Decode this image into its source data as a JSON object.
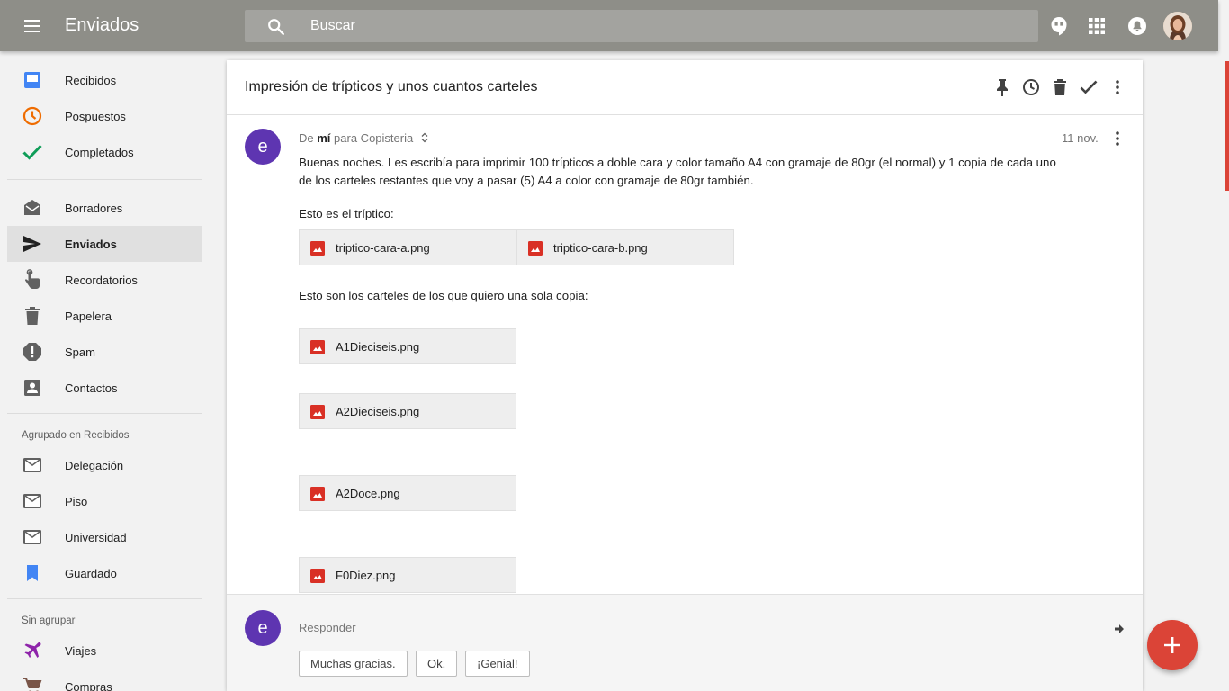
{
  "header": {
    "title": "Enviados",
    "search_placeholder": "Buscar"
  },
  "sidebar": {
    "items": [
      {
        "label": "Recibidos",
        "icon": "inbox-icon",
        "color": "#4285f4"
      },
      {
        "label": "Pospuestos",
        "icon": "clock-icon",
        "color": "#ef6c00"
      },
      {
        "label": "Completados",
        "icon": "check-icon",
        "color": "#0f9d58"
      },
      {
        "label": "Borradores",
        "icon": "drafts-icon",
        "color": "#616161"
      },
      {
        "label": "Enviados",
        "icon": "send-icon",
        "color": "#212121",
        "active": true
      },
      {
        "label": "Recordatorios",
        "icon": "finger-icon",
        "color": "#616161"
      },
      {
        "label": "Papelera",
        "icon": "trash-icon",
        "color": "#616161"
      },
      {
        "label": "Spam",
        "icon": "spam-icon",
        "color": "#616161"
      },
      {
        "label": "Contactos",
        "icon": "contacts-icon",
        "color": "#616161"
      }
    ],
    "grouped_heading": "Agrupado en Recibidos",
    "grouped": [
      {
        "label": "Delegación",
        "icon": "bundle-icon",
        "color": "#616161"
      },
      {
        "label": "Piso",
        "icon": "bundle-icon",
        "color": "#616161"
      },
      {
        "label": "Universidad",
        "icon": "bundle-icon",
        "color": "#616161"
      },
      {
        "label": "Guardado",
        "icon": "bookmark-icon",
        "color": "#4285f4"
      }
    ],
    "ungrouped_heading": "Sin agrupar",
    "ungrouped": [
      {
        "label": "Viajes",
        "icon": "plane-icon",
        "color": "#8e24aa"
      },
      {
        "label": "Compras",
        "icon": "cart-icon",
        "color": "#795548"
      }
    ]
  },
  "thread": {
    "subject": "Impresión de trípticos y unos cuantos carteles",
    "message": {
      "avatar_letter": "e",
      "from_prefix": "De",
      "from_name": "mí",
      "to_text": "para Copisteria",
      "date": "11 nov.",
      "body": "Buenas noches. Les escribía para imprimir 100 trípticos a doble cara y color tamaño A4 con gramaje de 80gr (el normal) y 1 copia de cada uno de los carteles restantes que voy a pasar (5) A4 a color con gramaje de 80gr también.",
      "triptico_intro": "Esto es el tríptico:",
      "triptico_files": [
        "triptico-cara-a.png",
        "triptico-cara-b.png"
      ],
      "carteles_intro": "Esto son los carteles de los que quiero una sola copia:",
      "cartel_files": [
        "A1Dieciseis.png",
        "A2Dieciseis.png",
        "A2Doce.png",
        "F0Diez.png"
      ]
    },
    "reply": {
      "avatar_letter": "e",
      "label": "Responder",
      "smart_replies": [
        "Muchas gracias.",
        "Ok.",
        "¡Genial!"
      ]
    }
  },
  "colors": {
    "accent": "#db4437",
    "topbar": "#8e8e88",
    "avatar": "#5e35b1"
  }
}
